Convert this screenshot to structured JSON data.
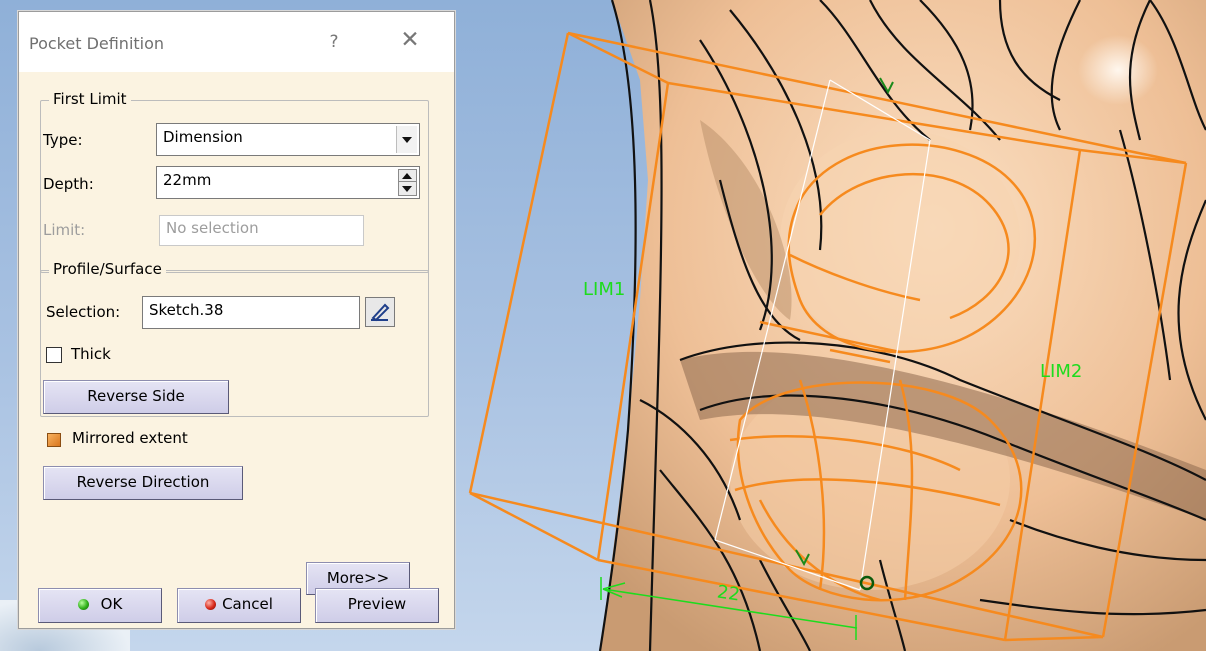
{
  "dialog": {
    "title": "Pocket Definition",
    "help_glyph": "?",
    "close_glyph": "✕",
    "first_limit": {
      "legend": "First Limit",
      "type_label": "Type:",
      "type_value": "Dimension",
      "depth_label": "Depth:",
      "depth_value": "22mm",
      "limit_label": "Limit:",
      "limit_value": "No selection"
    },
    "profile_surface": {
      "legend": "Profile/Surface",
      "selection_label": "Selection:",
      "selection_value": "Sketch.38",
      "thick_label": "Thick",
      "thick_checked": false,
      "reverse_side_label": "Reverse Side"
    },
    "mirrored_extent_label": "Mirrored extent",
    "mirrored_extent_checked": true,
    "reverse_direction_label": "Reverse Direction",
    "more_label": "More>>",
    "ok_label": "OK",
    "cancel_label": "Cancel",
    "preview_label": "Preview"
  },
  "viewport": {
    "lim1_label": "LIM1",
    "lim2_label": "LIM2",
    "dimension_value": "22",
    "colors": {
      "preview_box": "#f68a1e",
      "dimension": "#1ddc1d",
      "skin": "#f2c9a4",
      "background": "#a9c2e2"
    }
  }
}
